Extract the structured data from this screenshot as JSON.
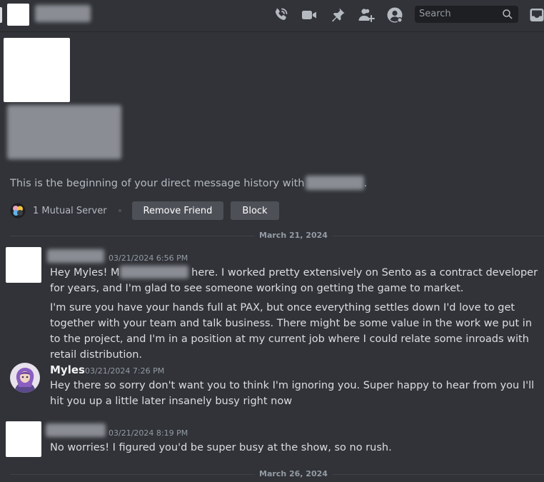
{
  "header": {
    "search_placeholder": "Search",
    "icons": [
      "call-icon",
      "video-icon",
      "pin-icon",
      "add-friend-icon",
      "profile-icon",
      "inbox-icon"
    ]
  },
  "intro": {
    "text": "This is the beginning of your direct message history with",
    "trailing": "."
  },
  "mutual": {
    "text": "1 Mutual Server",
    "remove_friend": "Remove Friend",
    "block": "Block"
  },
  "dividers": [
    "March 21, 2024",
    "March 26, 2024"
  ],
  "messages": [
    {
      "timestamp": "03/21/2024 6:56 PM",
      "para1_start": "Hey Myles! M",
      "para1_end": " here. I worked pretty extensively on Sento as a contract developer for years, and I'm glad to see someone working on getting the game to market.",
      "para2": "I'm sure you have your hands full at PAX, but once everything settles down I'd love to get together with your team and talk business. There might be some value in the work we put in to the project, and I'm in a position at my current job where I could relate some inroads with retail distribution."
    },
    {
      "author": "Myles",
      "timestamp": "03/21/2024 7:26 PM",
      "text": "Hey there so sorry don't want you to think I'm ignoring you. Super happy to hear from you I'll hit you up a little later insanely busy right now"
    },
    {
      "timestamp": "03/21/2024 8:19 PM",
      "text": "No worries! I figured you'd be super busy at the show, so no rush."
    }
  ],
  "colors": {
    "background": "#313338",
    "button": "#4e5058",
    "text": "#dbdee1",
    "muted": "#949ba4"
  }
}
